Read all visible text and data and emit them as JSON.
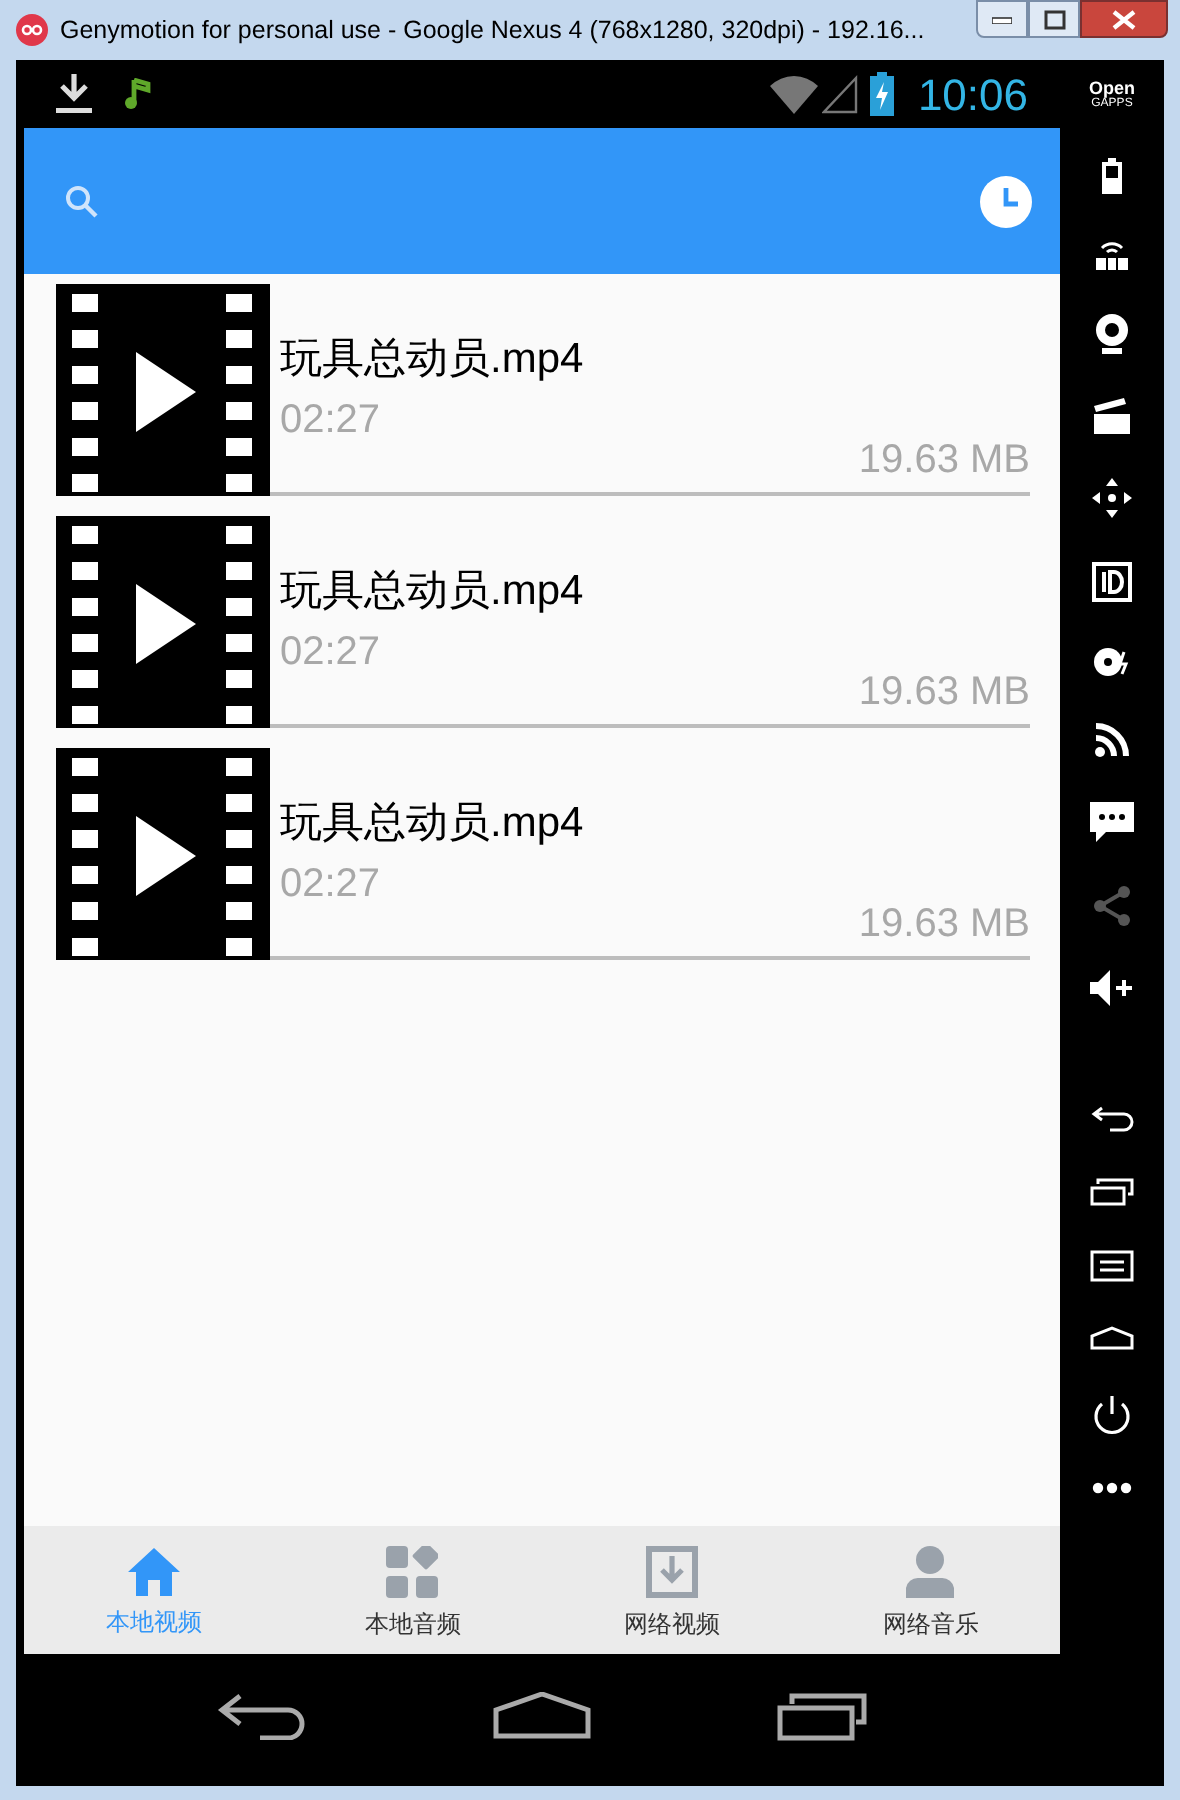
{
  "window": {
    "title": "Genymotion for personal use - Google Nexus 4 (768x1280, 320dpi) - 192.16..."
  },
  "status_bar": {
    "time": "10:06"
  },
  "videos": [
    {
      "name": "玩具总动员.mp4",
      "duration": "02:27",
      "size": "19.63 MB"
    },
    {
      "name": "玩具总动员.mp4",
      "duration": "02:27",
      "size": "19.63 MB"
    },
    {
      "name": "玩具总动员.mp4",
      "duration": "02:27",
      "size": "19.63 MB"
    }
  ],
  "tabs": [
    {
      "label": "本地视频",
      "kind": "home",
      "selected": true
    },
    {
      "label": "本地音频",
      "kind": "apps",
      "selected": false
    },
    {
      "label": "网络视频",
      "kind": "download",
      "selected": false
    },
    {
      "label": "网络音乐",
      "kind": "person",
      "selected": false
    }
  ],
  "side_toolbar": {
    "logo_top": "Open",
    "logo_bottom": "GAPPS"
  }
}
